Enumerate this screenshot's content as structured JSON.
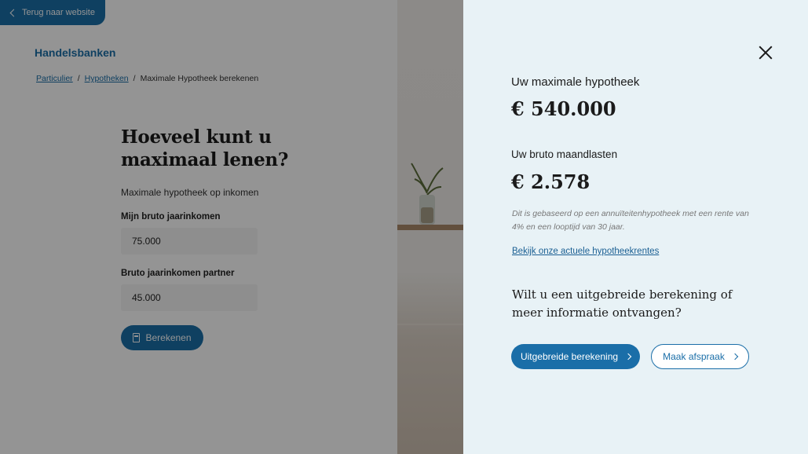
{
  "page": {
    "back_label": "Terug naar website",
    "logo": "Handelsbanken",
    "breadcrumb": [
      "Particulier",
      "Hypotheken",
      "Maximale Hypotheek berekenen"
    ],
    "breadcrumb_sep": "/",
    "headline": "Hoeveel kunt u maximaal lenen?",
    "subtitle": "Maximale hypotheek op inkomen",
    "income_label": "Mijn bruto jaarinkomen",
    "income_value": "75.000",
    "partner_label": "Bruto jaarinkomen partner",
    "partner_value": "45.000",
    "calculate_label": "Berekenen"
  },
  "panel": {
    "max_mortgage_label": "Uw maximale hypotheek",
    "max_mortgage_value": "€ 540.000",
    "monthly_label": "Uw bruto maandlasten",
    "monthly_value": "€ 2.578",
    "note": "Dit is gebaseerd op een annuïteitenhypotheek met een rente van 4% en een looptijd van 30 jaar.",
    "rates_link": "Bekijk onze actuele hypotheekrentes",
    "question": "Wilt u een uitgebreide berekening of meer informatie ontvangen?",
    "extended_button": "Uitgebreide berekening",
    "appointment_button": "Maak afspraak"
  },
  "colors": {
    "brand_blue": "#1a6ea8",
    "panel_bg": "#e8f2f6",
    "overlay": "rgba(0,0,0,0.42)"
  }
}
